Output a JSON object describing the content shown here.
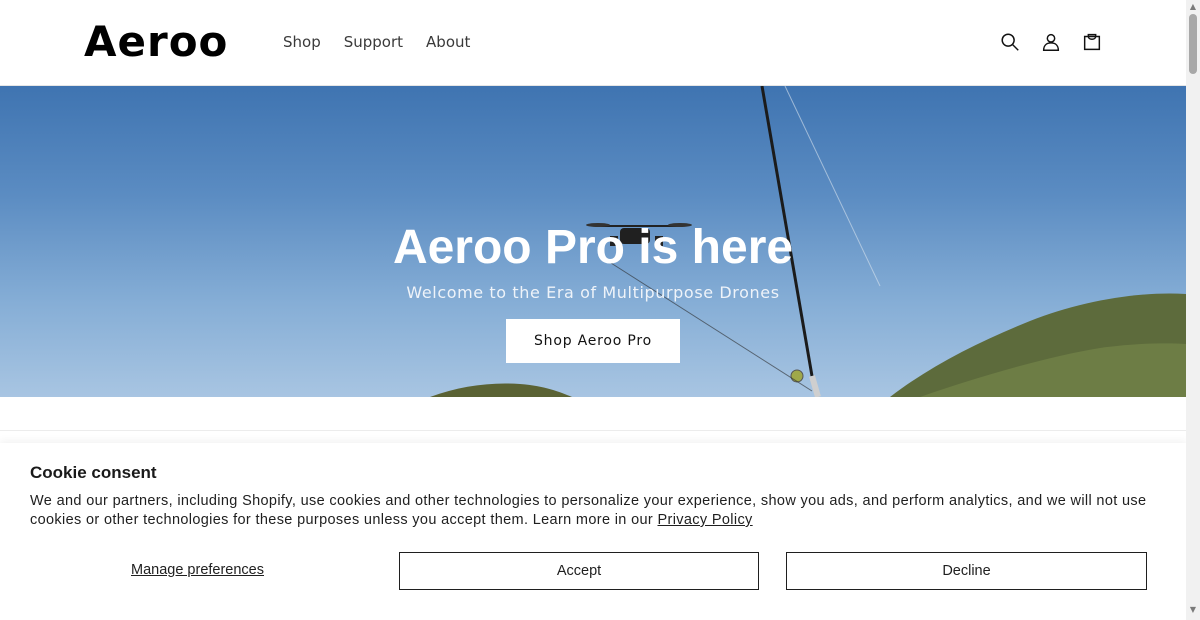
{
  "header": {
    "logo": "Aeroo",
    "nav": [
      {
        "label": "Shop"
      },
      {
        "label": "Support"
      },
      {
        "label": "About"
      }
    ],
    "icons": [
      "search-icon",
      "account-icon",
      "cart-icon"
    ]
  },
  "hero": {
    "title": "Aeroo Pro is here",
    "subtitle": "Welcome to the Era of Multipurpose Drones",
    "button": "Shop Aeroo Pro"
  },
  "cookie": {
    "title": "Cookie consent",
    "text": "We and our partners, including Shopify, use cookies and other technologies to personalize your experience, show you ads, and perform analytics, and we will not use cookies or other technologies for these purposes unless you accept them. Learn more in our ",
    "link": "Privacy Policy",
    "manage": "Manage preferences",
    "accept": "Accept",
    "decline": "Decline"
  },
  "colors": {
    "sky_top": "#3f74b1",
    "sky_bottom": "#a8c5e2",
    "hill": "#5f6b3a"
  }
}
